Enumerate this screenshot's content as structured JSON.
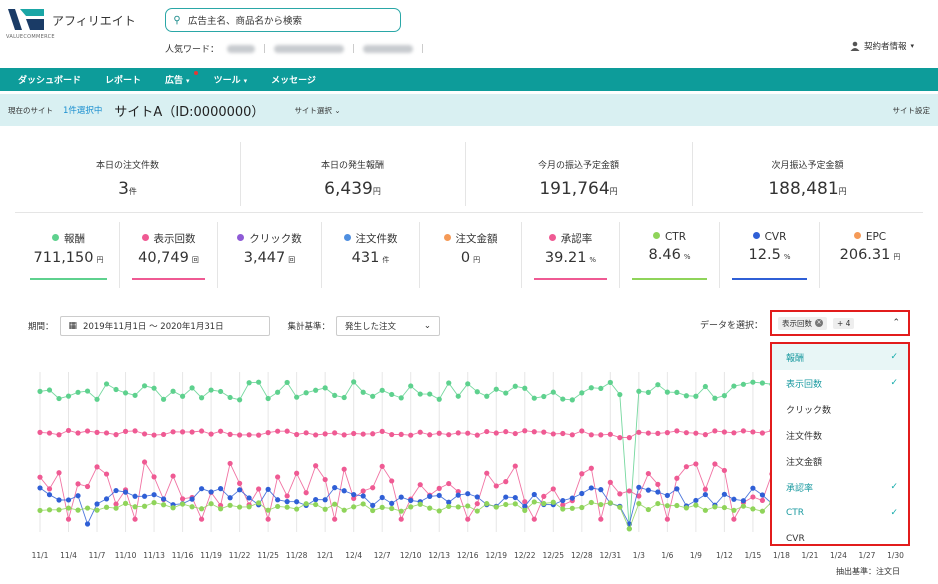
{
  "header": {
    "app_title": "アフィリエイト",
    "logo_sub": "VALUECOMMERCE",
    "search_placeholder": "広告主名、商品名から検索",
    "popular_label": "人気ワード：",
    "account_label": "契約者情報"
  },
  "nav": {
    "items": [
      {
        "label": "ダッシュボード",
        "caret": false,
        "dot": false
      },
      {
        "label": "レポート",
        "caret": false,
        "dot": false
      },
      {
        "label": "広告",
        "caret": true,
        "dot": true
      },
      {
        "label": "ツール",
        "caret": true,
        "dot": false
      },
      {
        "label": "メッセージ",
        "caret": false,
        "dot": false
      }
    ]
  },
  "site_bar": {
    "current_label": "現在のサイト",
    "selected": "1件選択中",
    "site_name": "サイトA（ID:0000000）",
    "select_label": "サイト選択",
    "settings_label": "サイト設定"
  },
  "summary": [
    {
      "title": "本日の注文件数",
      "value": "3",
      "unit": "件"
    },
    {
      "title": "本日の発生報酬",
      "value": "6,439",
      "unit": "円"
    },
    {
      "title": "今月の振込予定金額",
      "value": "191,764",
      "unit": "円"
    },
    {
      "title": "次月振込予定金額",
      "value": "188,481",
      "unit": "円"
    }
  ],
  "metrics": [
    {
      "label": "報酬",
      "value": "711,150",
      "unit": "円",
      "color": "#5ed18e",
      "line": "#5ed18e"
    },
    {
      "label": "表示回数",
      "value": "40,749",
      "unit": "回",
      "color": "#ef5a93",
      "line": "#ef5a93"
    },
    {
      "label": "クリック数",
      "value": "3,447",
      "unit": "回",
      "color": "#8e5bd6",
      "line": ""
    },
    {
      "label": "注文件数",
      "value": "431",
      "unit": "件",
      "color": "#4f8fe0",
      "line": ""
    },
    {
      "label": "注文金額",
      "value": "0",
      "unit": "円",
      "color": "#f59a57",
      "line": ""
    },
    {
      "label": "承認率",
      "value": "39.21",
      "unit": "%",
      "color": "#ef5a93",
      "line": "#ef5a93"
    },
    {
      "label": "CTR",
      "value": "8.46",
      "unit": "%",
      "color": "#8fd45a",
      "line": "#8fd45a"
    },
    {
      "label": "CVR",
      "value": "12.5",
      "unit": "%",
      "color": "#2f5fd6",
      "line": "#2f5fd6"
    },
    {
      "label": "EPC",
      "value": "206.31",
      "unit": "円",
      "color": "#f59a57",
      "line": ""
    }
  ],
  "filters": {
    "period_label": "期間：",
    "period_value": "2019年11月1日 〜 2020年1月31日",
    "basis_label": "集計基準：",
    "basis_value": "発生した注文",
    "data_select_label": "データを選択：",
    "chip": "表示回数",
    "more": "+ 4"
  },
  "dropdown": [
    {
      "label": "報酬",
      "checked": true
    },
    {
      "label": "表示回数",
      "checked": true
    },
    {
      "label": "クリック数",
      "checked": false
    },
    {
      "label": "注文件数",
      "checked": false
    },
    {
      "label": "注文金額",
      "checked": false
    },
    {
      "label": "承認率",
      "checked": true
    },
    {
      "label": "CTR",
      "checked": true
    },
    {
      "label": "CVR",
      "checked": false
    }
  ],
  "footer_note": "抽出基準：注文日",
  "chart_data": {
    "type": "line",
    "categories": [
      "11/1",
      "11/4",
      "11/7",
      "11/10",
      "11/13",
      "11/16",
      "11/19",
      "11/22",
      "11/25",
      "11/28",
      "12/1",
      "12/4",
      "12/7",
      "12/10",
      "12/13",
      "12/16",
      "12/19",
      "12/22",
      "12/25",
      "12/28",
      "12/31",
      "1/3",
      "1/6",
      "1/9",
      "1/12",
      "1/15",
      "1/18",
      "1/21",
      "1/24",
      "1/27",
      "1/30"
    ],
    "series": [
      {
        "name": "報酬",
        "color": "#5ed18e",
        "level": 0.88
      },
      {
        "name": "表示回数",
        "color": "#ef5a93",
        "level": 0.62
      },
      {
        "name": "承認率",
        "color": "#ef5a93",
        "level": 0.3
      },
      {
        "name": "CVR",
        "color": "#2f5fd6",
        "level": 0.22
      },
      {
        "name": "CTR",
        "color": "#8fd45a",
        "level": 0.16
      }
    ]
  }
}
